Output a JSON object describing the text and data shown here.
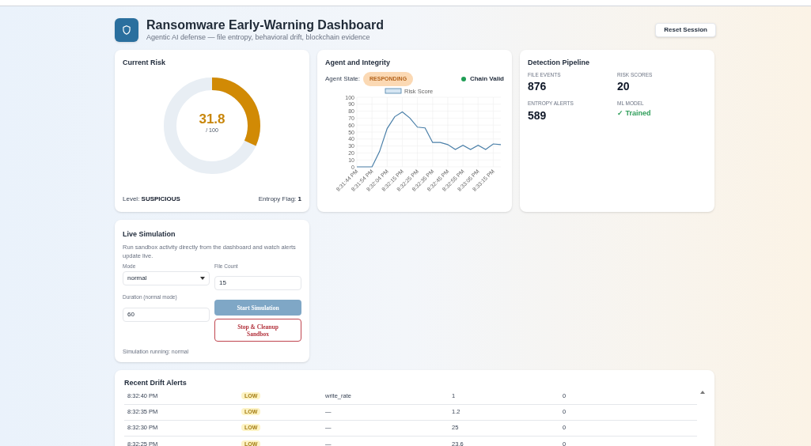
{
  "header": {
    "title": "Ransomware Early-Warning Dashboard",
    "subtitle": "Agentic AI defense — file entropy, behavioral drift, blockchain evidence",
    "reset_button": "Reset Session"
  },
  "current_risk": {
    "title": "Current Risk",
    "score": "31.8",
    "max": "/ 100",
    "level": 0.318,
    "level_label": "Level:",
    "level_value": "SUSPICIOUS",
    "entropy_label": "Entropy Flag:",
    "entropy_value": "1"
  },
  "agent": {
    "title": "Agent and Integrity",
    "state_label": "Agent State:",
    "state": "RESPONDING",
    "chain": "Chain Valid",
    "chain_valid": true,
    "chart_data": {
      "type": "line",
      "categories": [
        "8:31:44 PM",
        null,
        "8:31:54 PM",
        null,
        "8:32:04 PM",
        null,
        "8:32:15 PM",
        null,
        "8:32:25 PM",
        null,
        "8:32:35 PM",
        null,
        "8:32:45 PM",
        null,
        "8:32:55 PM",
        null,
        "8:33:05 PM",
        null,
        "8:33:15 PM",
        null
      ],
      "series": [
        {
          "name": "Risk Score",
          "color": "#4a7fa8",
          "values": [
            0,
            0,
            0,
            22,
            55,
            72,
            79,
            70,
            57,
            56,
            35,
            35,
            32,
            25,
            31,
            25,
            31,
            25,
            33,
            32
          ]
        }
      ],
      "grid": true,
      "ylim": [
        0,
        100
      ],
      "yticks": [
        0,
        10,
        20,
        30,
        40,
        50,
        60,
        70,
        80,
        90,
        100
      ]
    }
  },
  "pipeline": {
    "title": "Detection Pipeline",
    "stats": [
      {
        "label": "FILE EVENTS",
        "value": "876",
        "kind": "number"
      },
      {
        "label": "RISK SCORES",
        "value": "20",
        "kind": "number"
      },
      {
        "label": "ENTROPY ALERTS",
        "value": "589",
        "kind": "number"
      },
      {
        "label": "ML MODEL",
        "value": "✓ Trained",
        "kind": "status"
      }
    ]
  },
  "simulation": {
    "title": "Live Simulation",
    "description": "Run sandbox activity directly from the dashboard and watch alerts update live.",
    "mode_label": "Mode",
    "mode": "normal",
    "count_label": "File Count",
    "count": "15",
    "duration_label": "Duration (normal mode)",
    "duration": "60",
    "start_button": "Start Simulation",
    "start_disabled": true,
    "stop_button": "Stop & Cleanup Sandbox",
    "status": "Simulation running: normal"
  },
  "alerts": {
    "title": "Recent Drift Alerts",
    "rows": [
      {
        "time": "8:32:40 PM",
        "severity": "LOW",
        "metric": "write_rate",
        "value": "1",
        "column_5": "0"
      },
      {
        "time": "8:32:35 PM",
        "severity": "LOW",
        "metric": "—",
        "value": "1.2",
        "column_5": "0"
      },
      {
        "time": "8:32:30 PM",
        "severity": "LOW",
        "metric": "—",
        "value": "25",
        "column_5": "0"
      },
      {
        "time": "8:32:25 PM",
        "severity": "LOW",
        "metric": "—",
        "value": "23.6",
        "column_5": "0"
      }
    ]
  }
}
